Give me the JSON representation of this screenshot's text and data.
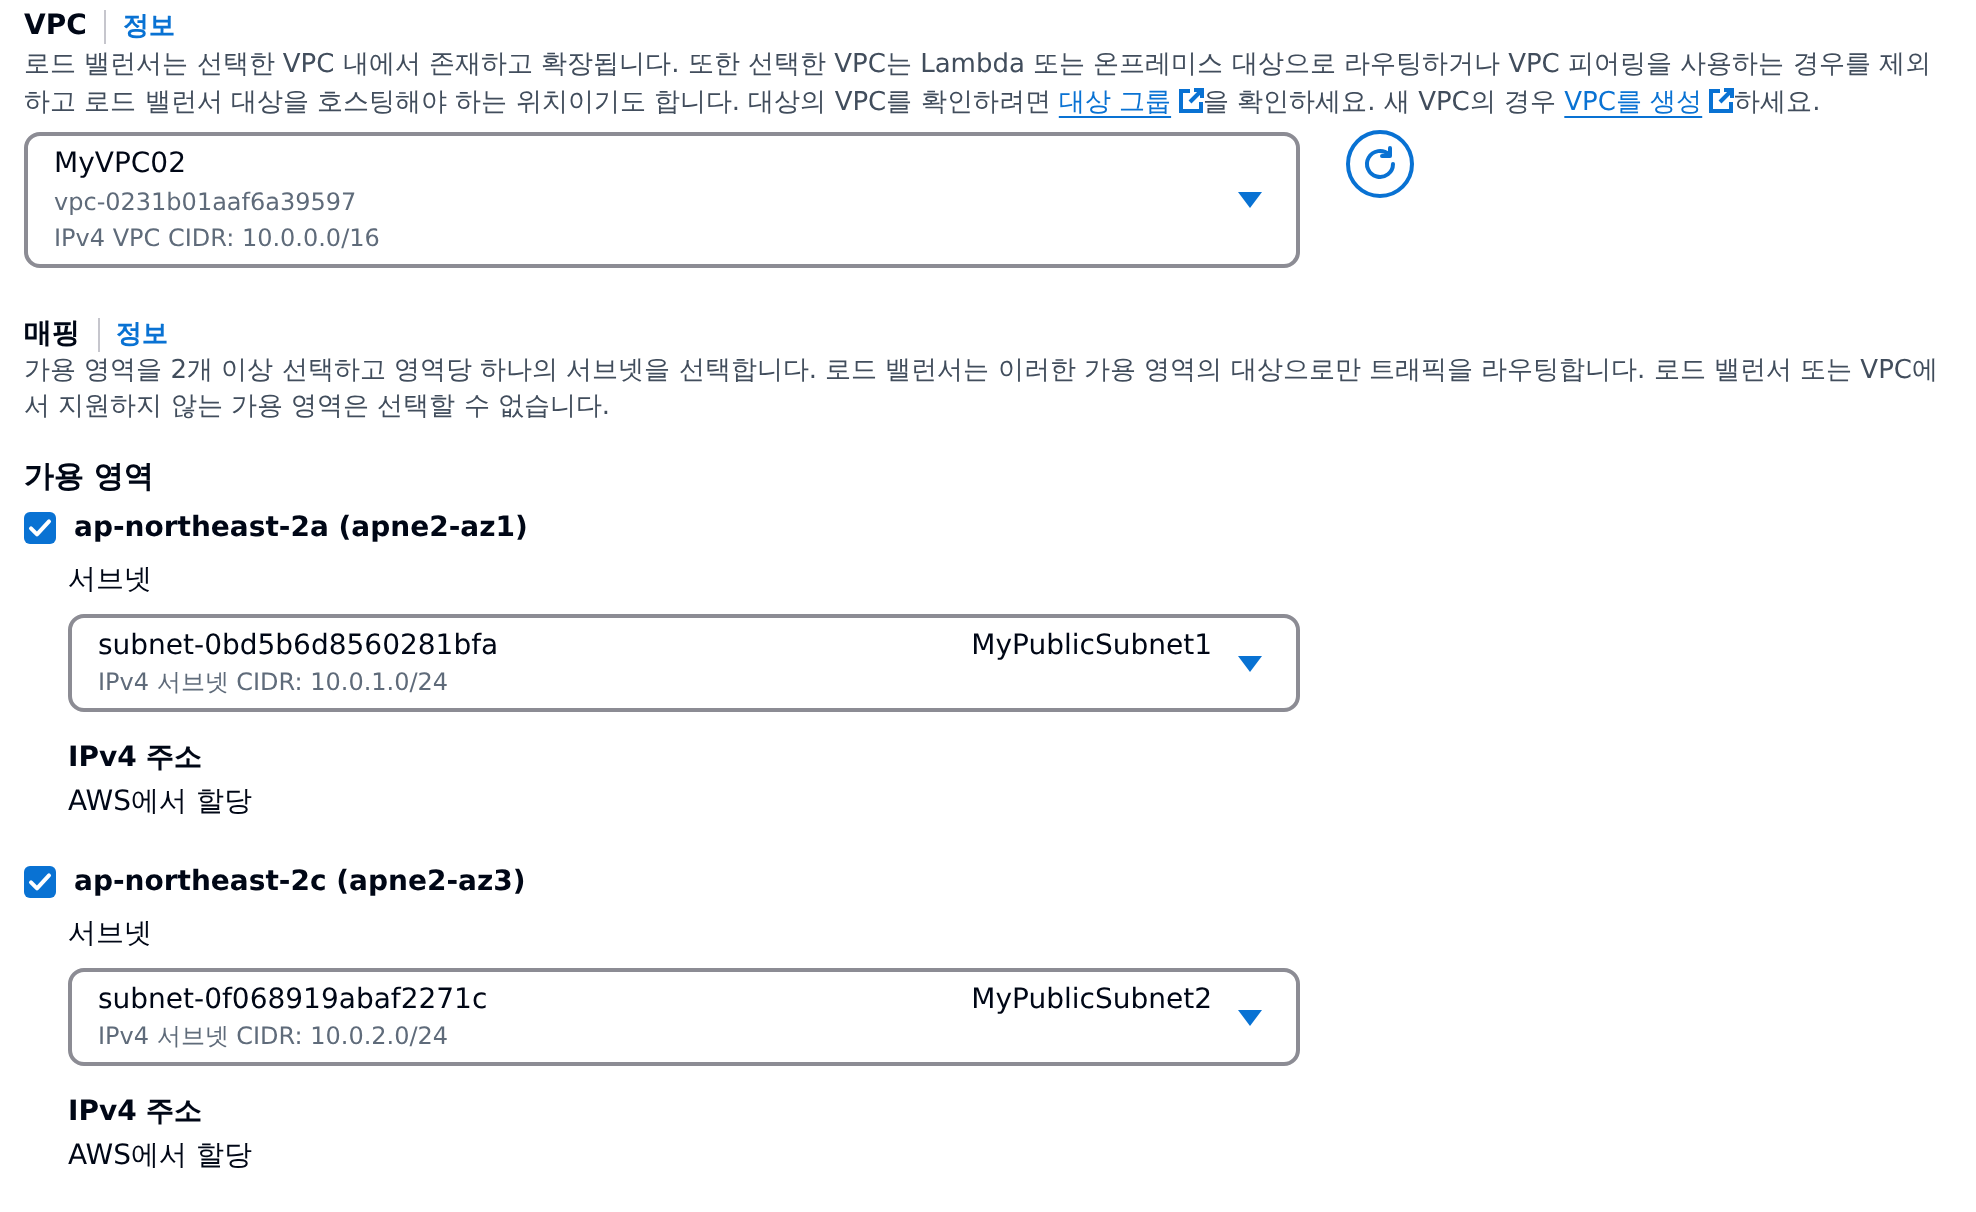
{
  "vpc": {
    "label": "VPC",
    "info_link": "정보",
    "description": [
      {
        "kind": "text",
        "text": "로드 밸런서는 선택한 VPC 내에서 존재하고 확장됩니다. 또한 선택한 VPC는 Lambda 또는 온프레미스 대상으로 라우팅하거나 VPC 피어링을 사용하는 경우를 제외하고 로드 밸런서 대상을 호스팅해야 하는 위치이기도 합니다. 대상의 VPC를 확인하려면 "
      },
      {
        "kind": "external_link",
        "text": "대상 그룹"
      },
      {
        "kind": "text",
        "text": "을 확인하세요. 새 VPC의 경우 "
      },
      {
        "kind": "external_link",
        "text": "VPC를 생성"
      },
      {
        "kind": "text",
        "text": "하세요."
      }
    ],
    "select": {
      "name": "MyVPC02",
      "id": "vpc-0231b01aaf6a39597",
      "cidr": "IPv4 VPC CIDR: 10.0.0.0/16"
    }
  },
  "mapping": {
    "label": "매핑",
    "info_link": "정보",
    "description": "가용 영역을 2개 이상 선택하고 영역당 하나의 서브넷을 선택합니다. 로드 밸런서는 이러한 가용 영역의 대상으로만 트래픽을 라우팅합니다. 로드 밸런서 또는 VPC에서 지원하지 않는 가용 영역은 선택할 수 없습니다.",
    "zones_label": "가용 영역",
    "zones": [
      {
        "name": "ap-northeast-2a (apne2-az1)",
        "checked": true,
        "subnet_label": "서브넷",
        "subnet": {
          "id": "subnet-0bd5b6d8560281bfa",
          "name": "MyPublicSubnet1",
          "cidr": "IPv4 서브넷 CIDR: 10.0.1.0/24"
        },
        "ipv4_label": "IPv4 주소",
        "ipv4_value": "AWS에서 할당"
      },
      {
        "name": "ap-northeast-2c (apne2-az3)",
        "checked": true,
        "subnet_label": "서브넷",
        "subnet": {
          "id": "subnet-0f068919abaf2271c",
          "name": "MyPublicSubnet2",
          "cidr": "IPv4 서브넷 CIDR: 10.0.2.0/24"
        },
        "ipv4_label": "IPv4 주소",
        "ipv4_value": "AWS에서 할당"
      }
    ]
  }
}
